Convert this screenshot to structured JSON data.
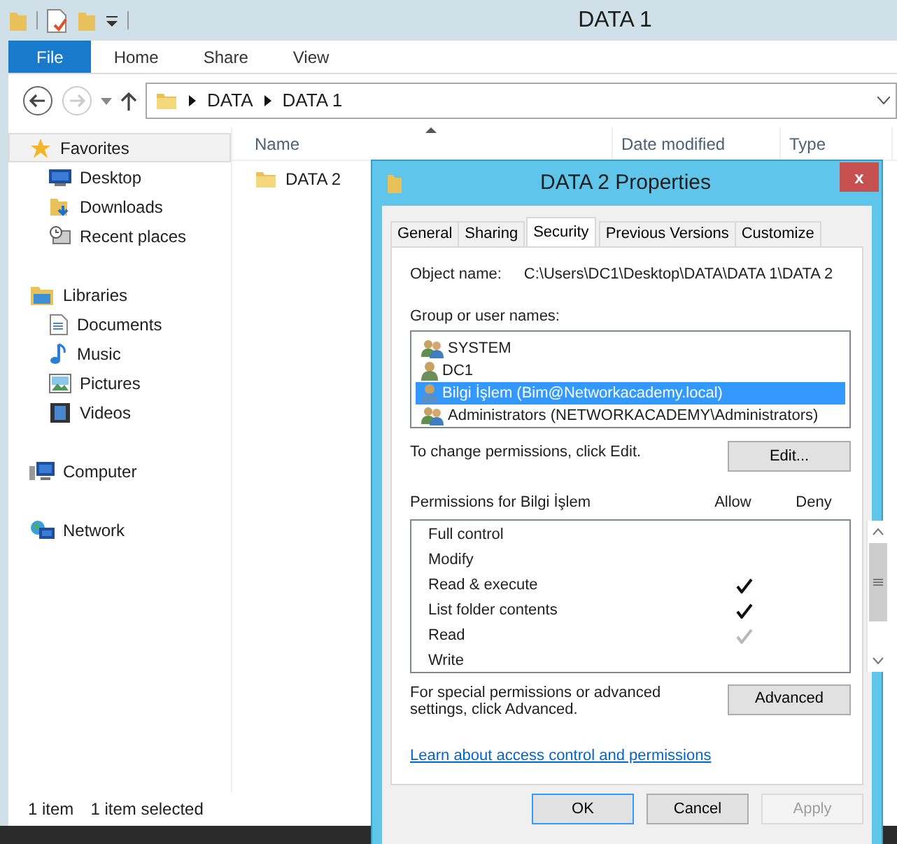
{
  "explorer": {
    "title": "DATA 1",
    "ribbon_tabs": [
      {
        "label": "File",
        "selected": true
      },
      {
        "label": "Home",
        "selected": false
      },
      {
        "label": "Share",
        "selected": false
      },
      {
        "label": "View",
        "selected": false
      }
    ],
    "breadcrumb": [
      "DATA",
      "DATA 1"
    ],
    "sidebar": [
      {
        "label": "Favorites",
        "selected": true,
        "children": [
          {
            "label": "Desktop",
            "selected": false
          },
          {
            "label": "Downloads",
            "selected": false
          },
          {
            "label": "Recent places",
            "selected": false
          }
        ]
      },
      {
        "label": "Libraries",
        "selected": false,
        "children": [
          {
            "label": "Documents",
            "selected": false
          },
          {
            "label": "Music",
            "selected": false
          },
          {
            "label": "Pictures",
            "selected": false
          },
          {
            "label": "Videos",
            "selected": false
          }
        ]
      },
      {
        "label": "Computer",
        "selected": false
      },
      {
        "label": "Network",
        "selected": false
      }
    ],
    "columns": [
      "Name",
      "Date modified",
      "Type"
    ],
    "files": [
      {
        "name": "DATA 2",
        "selected": false
      }
    ],
    "status_bar": [
      "1 item",
      "1 item selected"
    ]
  },
  "dialog": {
    "title": "DATA 2 Properties",
    "close": "x",
    "tabs": [
      {
        "label": "General",
        "selected": false
      },
      {
        "label": "Sharing",
        "selected": false
      },
      {
        "label": "Security",
        "selected": true
      },
      {
        "label": "Previous Versions",
        "selected": false
      },
      {
        "label": "Customize",
        "selected": false
      }
    ],
    "object_name_label": "Object name:",
    "object_name": "C:\\Users\\DC1\\Desktop\\DATA\\DATA 1\\DATA 2",
    "group_label": "Group or user names:",
    "principals": [
      {
        "name": "SYSTEM",
        "kind": "group",
        "selected": false
      },
      {
        "name": "DC1",
        "kind": "user",
        "selected": false
      },
      {
        "name": "Bilgi İşlem (Bim@Networkacademy.local)",
        "kind": "user",
        "selected": true
      },
      {
        "name": "Administrators (NETWORKACADEMY\\Administrators)",
        "kind": "group",
        "selected": false
      }
    ],
    "change_hint": "To change permissions, click Edit.",
    "edit_button": "Edit...",
    "permissions_label": "Permissions for Bilgi İşlem",
    "allow_label": "Allow",
    "deny_label": "Deny",
    "permissions": [
      {
        "name": "Full control",
        "allow": false,
        "deny": false
      },
      {
        "name": "Modify",
        "allow": false,
        "deny": false
      },
      {
        "name": "Read & execute",
        "allow": true,
        "inherited": false,
        "deny": false
      },
      {
        "name": "List folder contents",
        "allow": true,
        "inherited": false,
        "deny": false
      },
      {
        "name": "Read",
        "allow": true,
        "inherited": true,
        "deny": false
      },
      {
        "name": "Write",
        "allow": false,
        "deny": false
      }
    ],
    "advanced_hint": "For special permissions or advanced settings, click Advanced.",
    "advanced_button": "Advanced",
    "link": "Learn about access control and permissions",
    "buttons": [
      {
        "label": "OK",
        "disabled": false
      },
      {
        "label": "Cancel",
        "disabled": false
      },
      {
        "label": "Apply",
        "disabled": true
      }
    ]
  }
}
